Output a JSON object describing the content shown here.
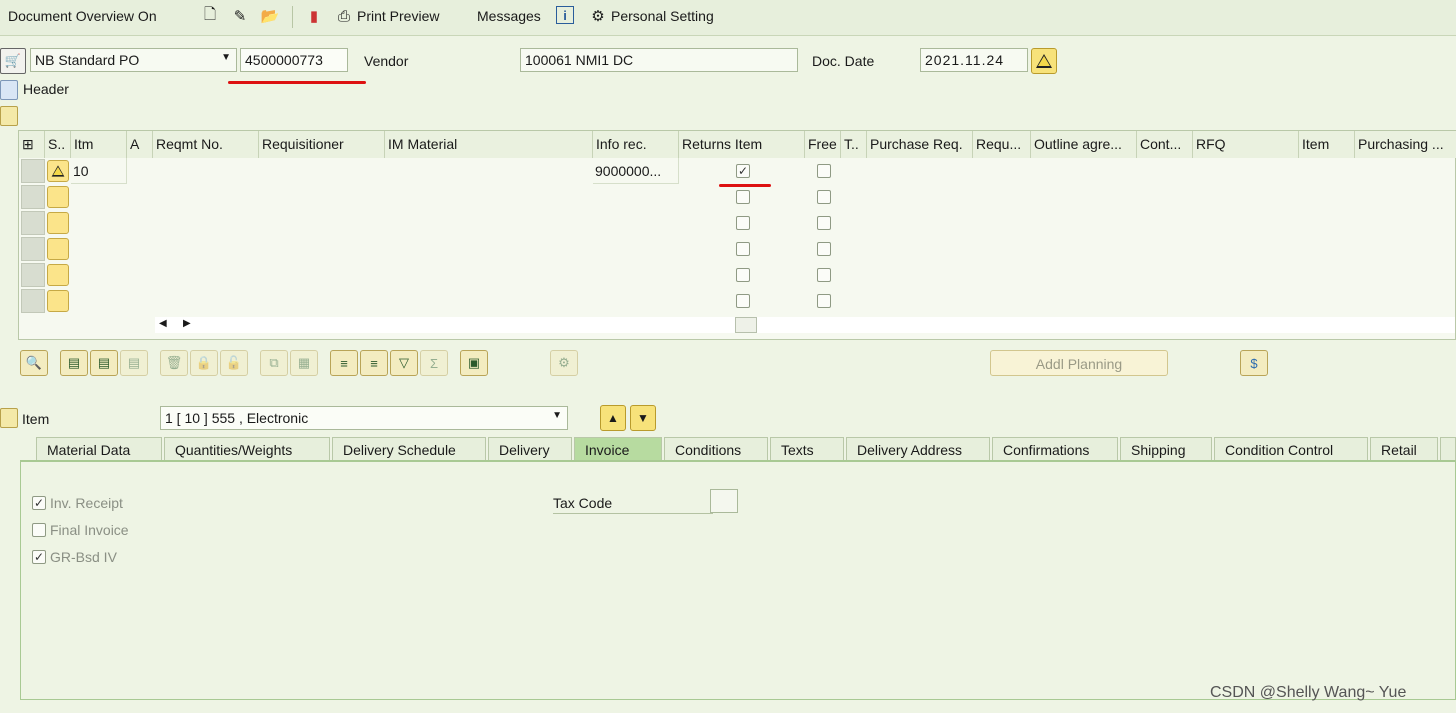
{
  "toolbar": {
    "doc_overview": "Document Overview On",
    "print_preview": "Print Preview",
    "messages": "Messages",
    "personal_setting": "Personal Setting"
  },
  "header": {
    "doc_type": "NB Standard PO",
    "po_number": "4500000773",
    "vendor_label": "Vendor",
    "vendor_value": "100061 NMI1 DC",
    "doc_date_label": "Doc. Date",
    "doc_date_value": "2021.11.24",
    "header_label": "Header"
  },
  "grid": {
    "columns": [
      "S..",
      "Itm",
      "A",
      "Reqmt No.",
      "Requisitioner",
      "IM Material",
      "Info rec.",
      "Returns Item",
      "Free",
      "T..",
      "Purchase Req.",
      "Requ...",
      "Outline agre...",
      "Cont...",
      "RFQ",
      "Item",
      "Purchasing ..."
    ],
    "rows": [
      {
        "itm": "10",
        "info_rec": "9000000...",
        "returns": true,
        "free": false
      },
      {
        "itm": "",
        "info_rec": "",
        "returns": false,
        "free": false
      },
      {
        "itm": "",
        "info_rec": "",
        "returns": false,
        "free": false
      },
      {
        "itm": "",
        "info_rec": "",
        "returns": false,
        "free": false
      },
      {
        "itm": "",
        "info_rec": "",
        "returns": false,
        "free": false
      },
      {
        "itm": "",
        "info_rec": "",
        "returns": false,
        "free": false
      }
    ]
  },
  "buttons": {
    "addl_planning": "Addl Planning"
  },
  "item": {
    "label": "Item",
    "selected": "1 [ 10 ] 555 , Electronic"
  },
  "tabs": [
    "Material Data",
    "Quantities/Weights",
    "Delivery Schedule",
    "Delivery",
    "Invoice",
    "Conditions",
    "Texts",
    "Delivery Address",
    "Confirmations",
    "Shipping",
    "Condition Control",
    "Retail"
  ],
  "invoice": {
    "inv_receipt": "Inv. Receipt",
    "final_invoice": "Final Invoice",
    "gr_bsd_iv": "GR-Bsd IV",
    "tax_code_label": "Tax Code"
  },
  "watermark": "CSDN @Shelly Wang~ Yue",
  "colors": {
    "accent_tab": "#b7dba0",
    "annotation": "#dd1111"
  }
}
